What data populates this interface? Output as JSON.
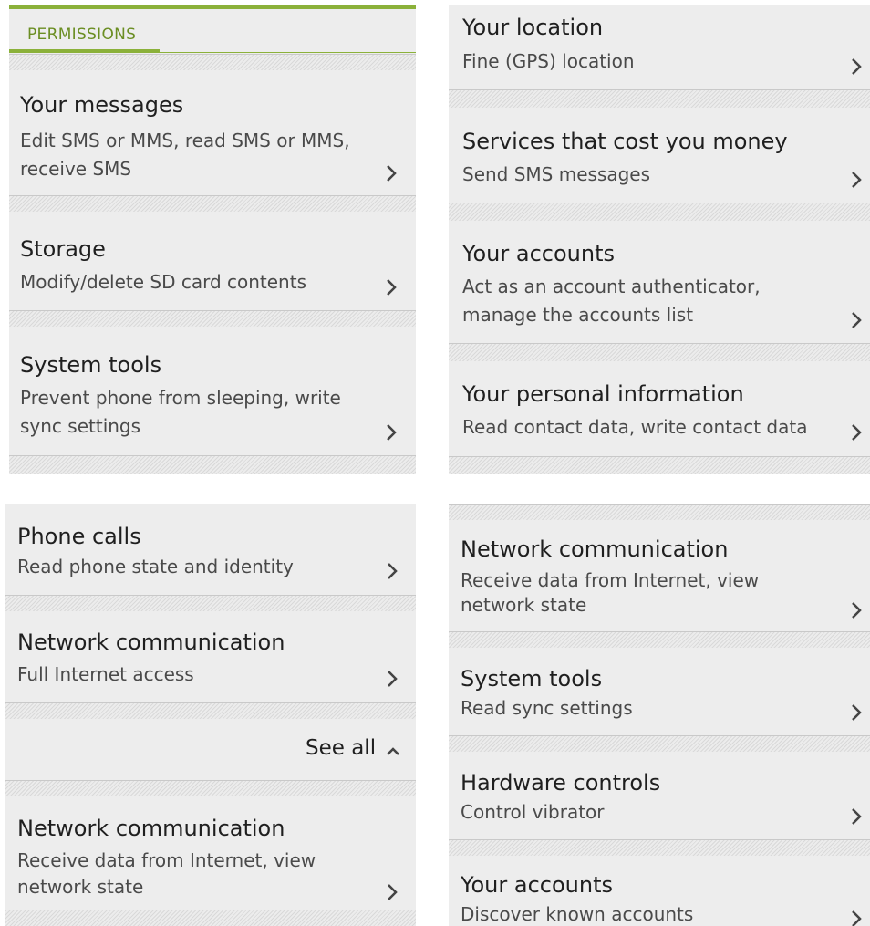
{
  "panel1": {
    "tab_label": "PERMISSIONS",
    "items": [
      {
        "title": "Your messages",
        "lines": [
          "Edit SMS or MMS, read SMS or MMS,",
          "receive SMS"
        ]
      },
      {
        "title": "Storage",
        "lines": [
          "Modify/delete SD card contents"
        ]
      },
      {
        "title": "System tools",
        "lines": [
          "Prevent phone from sleeping, write",
          "sync settings"
        ]
      }
    ]
  },
  "panel2": {
    "items": [
      {
        "title": "Your location",
        "lines": [
          "Fine (GPS) location"
        ]
      },
      {
        "title": "Services that cost you money",
        "lines": [
          "Send SMS messages"
        ]
      },
      {
        "title": "Your accounts",
        "lines": [
          "Act as an account authenticator,",
          "manage the accounts list"
        ]
      },
      {
        "title": "Your personal information",
        "lines": [
          "Read contact data, write contact data"
        ]
      }
    ]
  },
  "panel3": {
    "items": [
      {
        "title": "Phone calls",
        "lines": [
          "Read phone state and identity"
        ]
      },
      {
        "title": "Network communication",
        "lines": [
          "Full Internet access"
        ]
      },
      {
        "title": "Network communication",
        "lines": [
          "Receive data from Internet, view",
          "network state"
        ]
      }
    ],
    "see_all_label": "See all"
  },
  "panel4": {
    "items": [
      {
        "title": "Network communication",
        "lines": [
          "Receive data from Internet, view",
          "network state"
        ]
      },
      {
        "title": "System tools",
        "lines": [
          "Read sync settings"
        ]
      },
      {
        "title": "Hardware controls",
        "lines": [
          "Control vibrator"
        ]
      },
      {
        "title": "Your accounts",
        "lines": [
          "Discover known accounts"
        ]
      }
    ]
  },
  "icons": {
    "chevron": "chevron-right-icon",
    "collapse": "chevron-up-icon"
  },
  "colors": {
    "accent": "#8bb13a",
    "tab_text": "#6b8e23",
    "background": "#ededed"
  }
}
